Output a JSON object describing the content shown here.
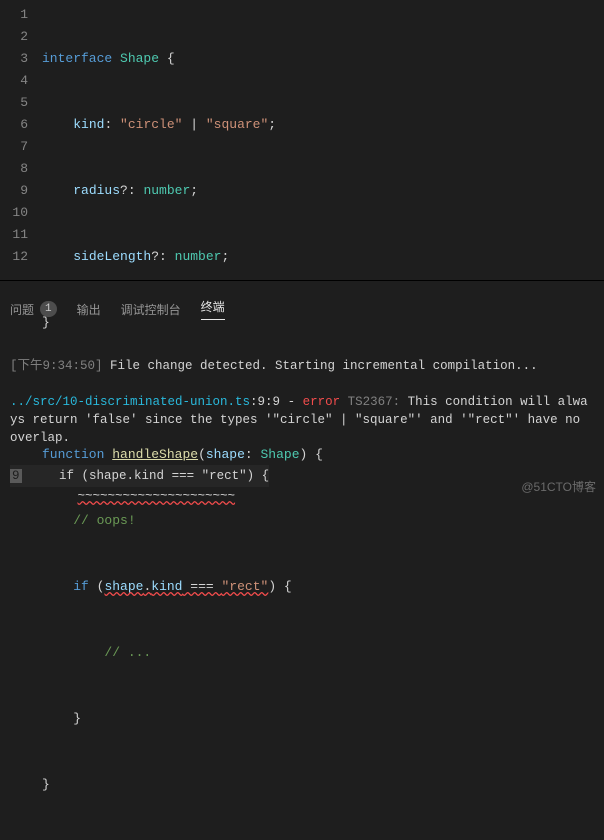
{
  "editor": {
    "lines": [
      1,
      2,
      3,
      4,
      5,
      6,
      7,
      8,
      9,
      10,
      11,
      12
    ],
    "l1": {
      "kw1": "interface",
      "type": "Shape",
      "brace": " {"
    },
    "l2": {
      "prop": "kind",
      "colon": ": ",
      "str1": "\"circle\"",
      "pipe": " | ",
      "str2": "\"square\"",
      "semi": ";"
    },
    "l3": {
      "prop": "radius",
      "opt": "?: ",
      "type": "number",
      "semi": ";"
    },
    "l4": {
      "prop": "sideLength",
      "opt": "?: ",
      "type": "number",
      "semi": ";"
    },
    "l5": {
      "brace": "}"
    },
    "l7": {
      "kw": "function",
      "fn": "handleShape",
      "open": "(",
      "param": "shape",
      "colon": ": ",
      "type": "Shape",
      "close": ") {"
    },
    "l8": {
      "comment": "// oops!"
    },
    "l9": {
      "kw": "if",
      "open": " (",
      "obj": "shape",
      "dot": ".",
      "prop": "kind",
      "eq": " === ",
      "str": "\"rect\"",
      "close": ") {"
    },
    "l10": {
      "comment": "// ..."
    },
    "l11": {
      "brace": "}"
    },
    "l12": {
      "brace": "}"
    }
  },
  "panel": {
    "tabs": {
      "problems": "问题",
      "problems_count": "1",
      "output": "输出",
      "debug": "调试控制台",
      "terminal": "终端"
    },
    "term": {
      "time": "[下午9:34:50]",
      "msg1": " File change detected. Starting incremental compilation...",
      "path": "../src/10-discriminated-union.ts",
      "loc": ":9:9",
      "dash": " - ",
      "err": "error",
      "code": " TS2367: ",
      "msg2": "This condition will always return 'false' since the types '\"circle\" | \"square\"' and '\"rect\"' have no overlap.",
      "linenum": "9",
      "snippet_if": "if",
      "snippet_open": " (shape.kind ",
      "snippet_eq": "===",
      "snippet_str": " \"rect\"",
      "snippet_close": ") {"
    }
  },
  "watermark": "@51CTO博客"
}
